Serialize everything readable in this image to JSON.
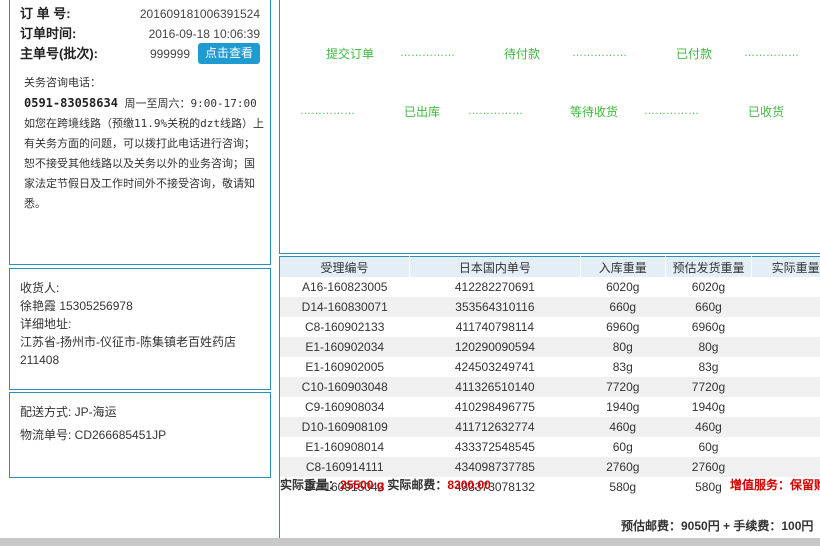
{
  "order": {
    "order_no_label": "订 单 号:",
    "order_no": "201609181006391524",
    "time_label": "订单时间:",
    "time": "2016-09-18 10:06:39",
    "master_label": "主单号(批次):",
    "master_no": "999999",
    "view_button": "点击查看"
  },
  "consult": {
    "title": "关务咨询电话：",
    "phone": "0591-83058634",
    "hours": "周一至周六：9:00-17:00",
    "text": "如您在跨境线路（预缴11.9%关税的dzt线路）上有关务方面的问题，可以拨打此电话进行咨询；恕不接受其他线路以及关务以外的业务咨询；国家法定节假日及工作时间外不接受咨询，敬请知悉。"
  },
  "receiver": {
    "label": "收货人:",
    "name_phone": "徐艳霞 15305256978",
    "address_label": "详细地址:",
    "address_line1": "江苏省-扬州市-仪征市-陈集镇老百姓药店",
    "address_line2": "211408"
  },
  "shipping": {
    "method": "配送方式: JP-海运",
    "tracking": "物流单号: CD266685451JP"
  },
  "progress": {
    "steps": [
      "提交订单",
      "待付款",
      "已付款",
      "已出库",
      "等待收货",
      "已收货"
    ],
    "dots": "……………"
  },
  "table": {
    "headers": [
      "受理编号",
      "日本国内单号",
      "入库重量",
      "预估发货重量",
      "实际重量"
    ],
    "rows": [
      [
        "A16-160823005",
        "412282270691",
        "6020g",
        "6020g",
        ""
      ],
      [
        "D14-160830071",
        "353564310116",
        "660g",
        "660g",
        ""
      ],
      [
        "C8-160902133",
        "411740798114",
        "6960g",
        "6960g",
        ""
      ],
      [
        "E1-160902034",
        "120290090594",
        "80g",
        "80g",
        ""
      ],
      [
        "E1-160902005",
        "424503249741",
        "83g",
        "83g",
        ""
      ],
      [
        "C10-160903048",
        "411326510140",
        "7720g",
        "7720g",
        ""
      ],
      [
        "C9-160908034",
        "410298496775",
        "1940g",
        "1940g",
        ""
      ],
      [
        "D10-160908109",
        "411712632774",
        "460g",
        "460g",
        ""
      ],
      [
        "E1-160908014",
        "433372548545",
        "60g",
        "60g",
        ""
      ],
      [
        "C8-160914111",
        "434098737785",
        "2760g",
        "2760g",
        ""
      ],
      [
        "D7-160915043",
        "433373078132",
        "580g",
        "580g",
        ""
      ]
    ]
  },
  "summary": {
    "actual_weight_label": "实际重量：",
    "actual_weight": "25500 g",
    "actual_postage_label": "实际邮费：",
    "actual_postage": "8300.00",
    "value_added": "增值服务：保留购",
    "estimate": "预估邮费：9050円 + 手续费：100円"
  }
}
